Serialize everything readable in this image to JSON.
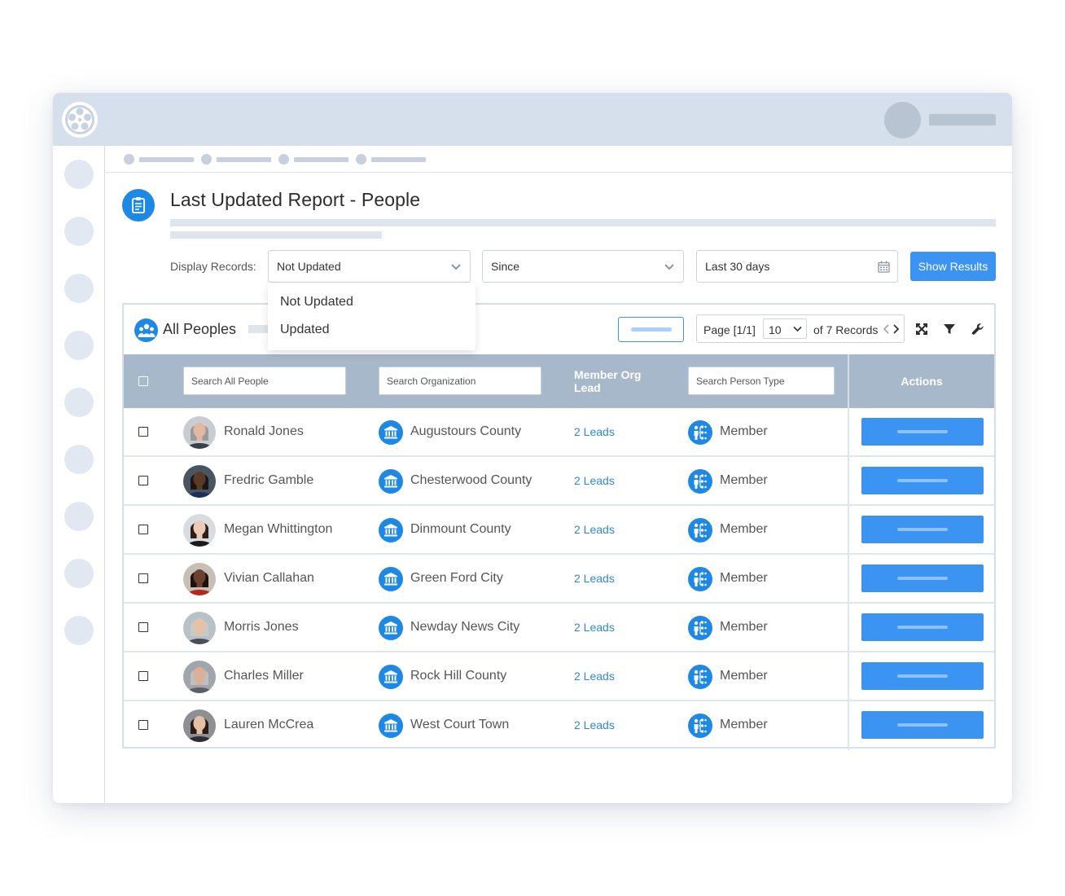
{
  "app": {
    "logo_icon": "film-reel-logo-icon",
    "accent": "#1e88e5",
    "button_blue": "#3b94f2",
    "header_bg": "#d5e0ec",
    "table_head_bg": "#a8b8cb"
  },
  "page": {
    "title": "Last Updated Report - People",
    "title_icon": "report-document-icon"
  },
  "filters": {
    "label": "Display Records:",
    "status_value": "Not Updated",
    "period_value": "Since",
    "range_value": "Last 30 days",
    "range_icon": "calendar-icon",
    "submit_label": "Show Results",
    "dropdown_options": [
      "Not Updated",
      "Updated"
    ]
  },
  "panel": {
    "title": "All Peoples",
    "title_icon": "people-group-icon",
    "pager": {
      "label": "Page [1/1]",
      "page_size": "10",
      "records": "of 7 Records",
      "prev": "‹",
      "next": "›"
    },
    "tools": [
      "expand-icon",
      "filter-icon",
      "wrench-icon"
    ]
  },
  "table": {
    "search_people_placeholder": "Search All People",
    "search_org_placeholder": "Search Organization",
    "lead_header": "Member Org Lead",
    "search_type_placeholder": "Search Person Type",
    "actions_header": "Actions",
    "rows": [
      {
        "name": "Ronald Jones",
        "org": "Augustours County",
        "leads": "2 Leads",
        "type": "Member",
        "skin": "#e2b9a0",
        "hair": "#9a9a9a",
        "shirt": "#3a3f4a",
        "bg": "#c9ccd1"
      },
      {
        "name": "Fredric Gamble",
        "org": "Chesterwood County",
        "leads": "2 Leads",
        "type": "Member",
        "skin": "#5c3a28",
        "hair": "#1d1511",
        "shirt": "#1f2f5a",
        "bg": "#4a5563"
      },
      {
        "name": "Megan Whittington",
        "org": "Dinmount County",
        "leads": "2 Leads",
        "type": "Member",
        "skin": "#edcab3",
        "hair": "#2b1e17",
        "shirt": "#1b1b1b",
        "bg": "#d9dcde"
      },
      {
        "name": "Vivian Callahan",
        "org": "Green Ford City",
        "leads": "2 Leads",
        "type": "Member",
        "skin": "#6b4030",
        "hair": "#1b120d",
        "shirt": "#b3271f",
        "bg": "#c7bfb6"
      },
      {
        "name": "Morris Jones",
        "org": "Newday News City",
        "leads": "2 Leads",
        "type": "Member",
        "skin": "#e5c1a8",
        "hair": "#c9c9c9",
        "shirt": "#4a4e57",
        "bg": "#b8c0c8"
      },
      {
        "name": "Charles Miller",
        "org": "Rock Hill County",
        "leads": "2 Leads",
        "type": "Member",
        "skin": "#dcb096",
        "hair": "#bfbfbf",
        "shirt": "#5b5f66",
        "bg": "#9fa6ad"
      },
      {
        "name": "Lauren McCrea",
        "org": "West Court Town",
        "leads": "2 Leads",
        "type": "Member",
        "skin": "#e4c0a5",
        "hair": "#2a1c15",
        "shirt": "#2e2e36",
        "bg": "#8d8f93"
      }
    ]
  }
}
